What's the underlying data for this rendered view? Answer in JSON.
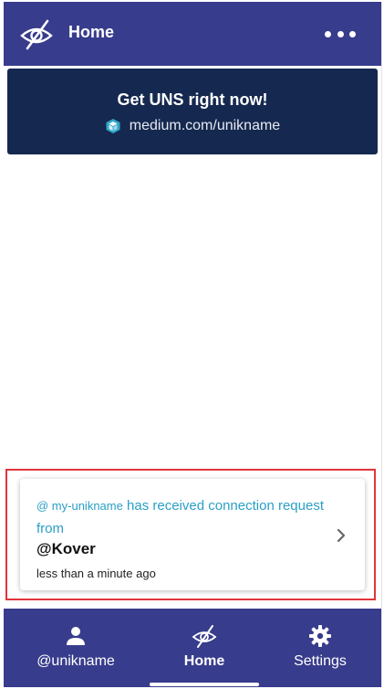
{
  "header": {
    "title": "Home",
    "logo_icon": "eye-slash-icon",
    "more_icon": "more-horizontal-icon"
  },
  "banner": {
    "title": "Get UNS right now!",
    "link_text": "medium.com/unikname",
    "link_icon": "cube-logo-icon"
  },
  "notification": {
    "at_handle": "@ my-unikname",
    "message": "has received connection request from",
    "from": "@Kover",
    "time": "less than a minute ago",
    "chevron_icon": "chevron-right-icon"
  },
  "bottom_nav": {
    "items": [
      {
        "label": "@unikname",
        "icon": "person-icon",
        "active": false
      },
      {
        "label": "Home",
        "icon": "eye-slash-icon",
        "active": true
      },
      {
        "label": "Settings",
        "icon": "gear-icon",
        "active": false
      }
    ]
  },
  "colors": {
    "header_bg": "#383c8c",
    "banner_bg": "#15284f",
    "accent_text": "#2a9fc6",
    "highlight_border": "#e0353a"
  }
}
